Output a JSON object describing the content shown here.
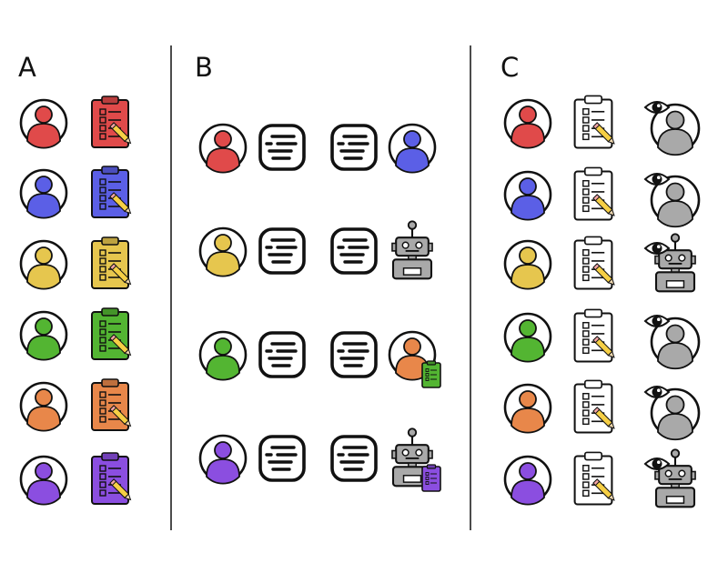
{
  "panels": {
    "a": {
      "label": "A"
    },
    "b": {
      "label": "B"
    },
    "c": {
      "label": "C"
    }
  },
  "colors": {
    "red": "#e04a4a",
    "blue": "#5b5fe6",
    "yellow": "#e6c64e",
    "green": "#53b532",
    "orange": "#e8874a",
    "purple": "#8b4ee0",
    "gray": "#a9a9a9",
    "pencil": "#f6cf45",
    "pencil_tip": "#f3a5a5"
  },
  "panel_a": {
    "rows": [
      {
        "person": "red",
        "clipboard": "red"
      },
      {
        "person": "blue",
        "clipboard": "blue"
      },
      {
        "person": "yellow",
        "clipboard": "yellow"
      },
      {
        "person": "green",
        "clipboard": "green"
      },
      {
        "person": "orange",
        "clipboard": "orange"
      },
      {
        "person": "purple",
        "clipboard": "purple"
      }
    ]
  },
  "panel_b": {
    "rows": [
      {
        "sender": "red",
        "receiver": "person-blue",
        "badge": ""
      },
      {
        "sender": "yellow",
        "receiver": "robot",
        "badge": ""
      },
      {
        "sender": "green",
        "receiver": "person-orange",
        "badge": "green"
      },
      {
        "sender": "purple",
        "receiver": "robot",
        "badge": "purple"
      }
    ]
  },
  "panel_c": {
    "rows": [
      {
        "person": "red",
        "observer": "person"
      },
      {
        "person": "blue",
        "observer": "person"
      },
      {
        "person": "yellow",
        "observer": "robot"
      },
      {
        "person": "green",
        "observer": "person"
      },
      {
        "person": "orange",
        "observer": "person"
      },
      {
        "person": "purple",
        "observer": "robot"
      }
    ]
  }
}
